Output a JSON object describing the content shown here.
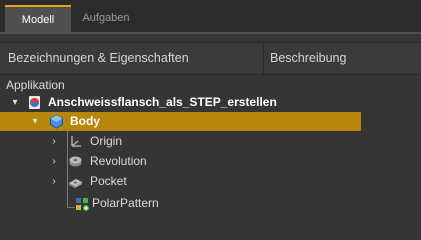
{
  "tabs": {
    "active": "Modell",
    "inactive": "Aufgaben"
  },
  "header": {
    "col1": "Bezeichnungen & Eigenschaften",
    "col2": "Beschreibung"
  },
  "tree": {
    "section": "Applikation",
    "root": "Anschweissflansch_als_STEP_erstellen",
    "body": "Body",
    "children": [
      "Origin",
      "Revolution",
      "Pocket",
      "PolarPattern"
    ]
  },
  "colors": {
    "accent": "#e7a21a",
    "selection": "#b8860b"
  }
}
